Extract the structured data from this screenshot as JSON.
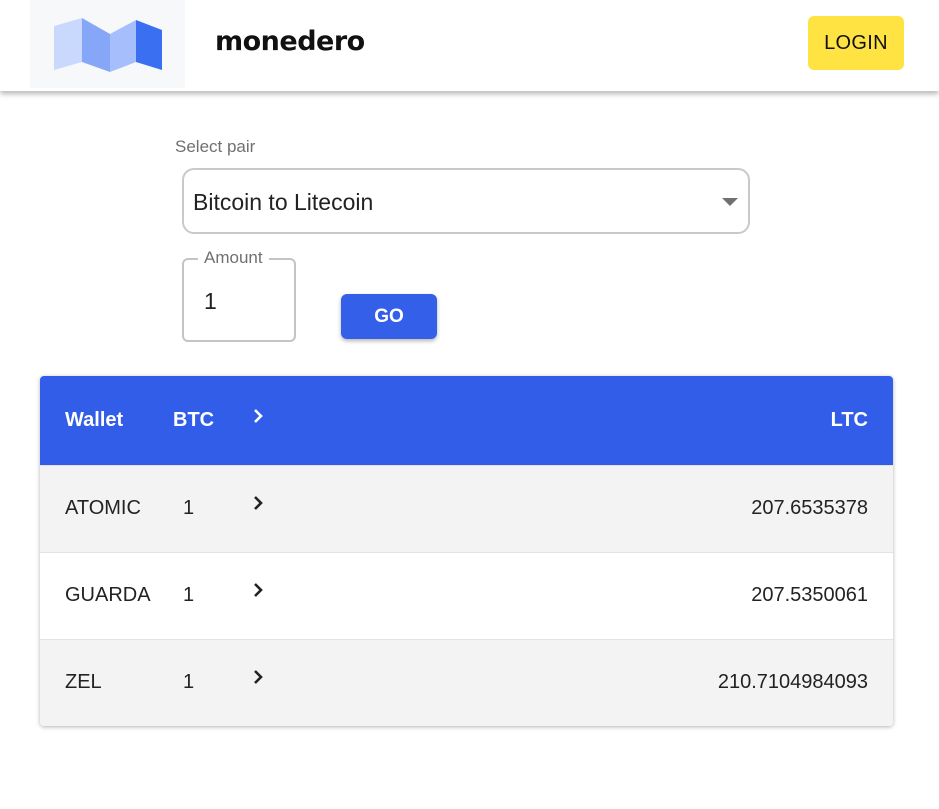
{
  "header": {
    "brand": "monedero",
    "login_label": "LOGIN"
  },
  "form": {
    "select_label": "Select pair",
    "selected_pair": "Bitcoin to Litecoin",
    "amount_label": "Amount",
    "amount_value": "1",
    "go_label": "GO"
  },
  "table": {
    "headers": {
      "wallet": "Wallet",
      "from": "BTC",
      "to": "LTC"
    },
    "rows": [
      {
        "wallet": "ATOMIC",
        "amount": "1",
        "result": "207.6535378"
      },
      {
        "wallet": "GUARDA",
        "amount": "1",
        "result": "207.5350061"
      },
      {
        "wallet": "ZEL",
        "amount": "1",
        "result": "210.7104984093"
      }
    ]
  },
  "colors": {
    "accent_blue": "#325de8",
    "login_yellow": "#ffe343",
    "row_gray": "#f3f3f3"
  },
  "icons": [
    "monedero-logo",
    "chevron-right-icon",
    "dropdown-arrow-icon"
  ]
}
